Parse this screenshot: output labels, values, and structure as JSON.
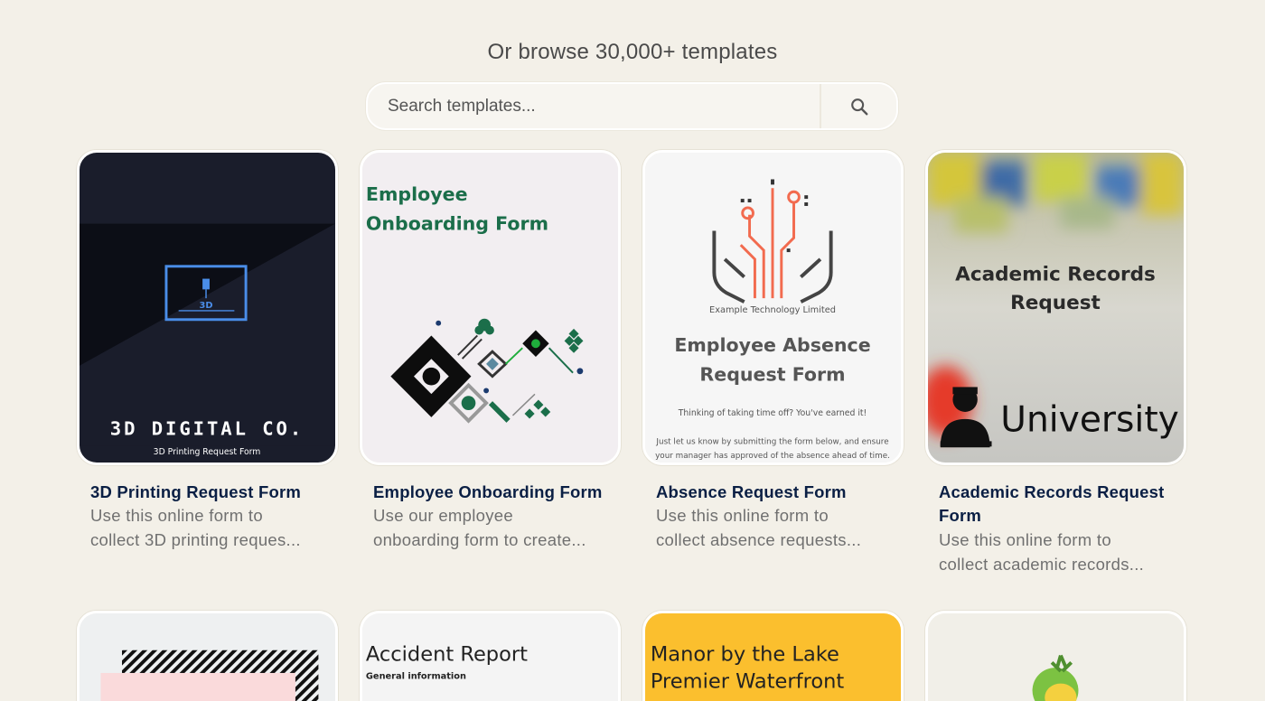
{
  "heading": "Or browse 30,000+ templates",
  "search": {
    "placeholder": "Search templates...",
    "button_icon": "search-icon"
  },
  "templates": [
    {
      "title": "3D Printing Request Form",
      "desc_line1": "Use this online form to",
      "desc_line2": "collect 3D printing reques...",
      "thumb_brand": "3D DIGITAL CO.",
      "thumb_sub": "3D Printing Request Form",
      "thumb_badge": "3D"
    },
    {
      "title": "Employee Onboarding Form",
      "desc_line1": "Use our employee",
      "desc_line2": "onboarding form to create...",
      "thumb_title1": "Employee",
      "thumb_title2": "Onboarding Form"
    },
    {
      "title": "Absence Request Form",
      "desc_line1": "Use this online form to",
      "desc_line2": "collect absence requests...",
      "thumb_company": "Example Technology Limited",
      "thumb_title1": "Employee Absence",
      "thumb_title2": "Request Form",
      "thumb_line1": "Thinking of taking time off? You've earned it!",
      "thumb_line2": "Just let us know by submitting the form below, and ensure",
      "thumb_line3": "your manager has approved of the absence ahead of time."
    },
    {
      "title_line1": "Academic Records Request",
      "title_line2": "Form",
      "desc_line1": "Use this online form to",
      "desc_line2": "collect academic records...",
      "thumb_title1": "Academic Records",
      "thumb_title2": "Request",
      "thumb_brand": "University"
    }
  ],
  "second_row": [
    {
      "thumb_title": ""
    },
    {
      "thumb_title": "Accident Report",
      "thumb_sub": "General information"
    },
    {
      "thumb_title1": "Manor by the Lake",
      "thumb_title2": "Premier Waterfront"
    },
    {
      "thumb_title": ""
    }
  ],
  "colors": {
    "background": "#f3f0e8",
    "title_text": "#0a1f44",
    "desc_text": "#707070",
    "onboarding_green": "#1b6e4a",
    "absence_orange": "#f26b4f",
    "manor_yellow": "#fbbf2e"
  }
}
